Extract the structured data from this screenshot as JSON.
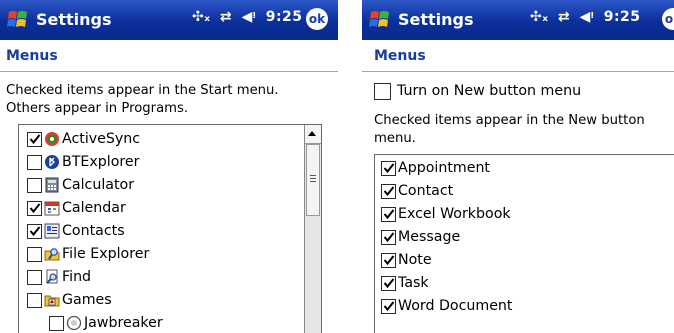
{
  "left": {
    "title": "Settings",
    "time": "9:25",
    "ok_label": "ok",
    "section_header": "Menus",
    "description_lines": [
      "Checked items appear in the Start menu.",
      "Others appear in Programs."
    ],
    "items": [
      {
        "label": "ActiveSync",
        "checked": true,
        "icon": "activesync-icon"
      },
      {
        "label": "BTExplorer",
        "checked": false,
        "icon": "btexplorer-icon"
      },
      {
        "label": "Calculator",
        "checked": false,
        "icon": "calculator-icon"
      },
      {
        "label": "Calendar",
        "checked": true,
        "icon": "calendar-icon"
      },
      {
        "label": "Contacts",
        "checked": true,
        "icon": "contacts-icon"
      },
      {
        "label": "File Explorer",
        "checked": false,
        "icon": "file-explorer-icon"
      },
      {
        "label": "Find",
        "checked": false,
        "icon": "find-icon"
      },
      {
        "label": "Games",
        "checked": false,
        "icon": "games-folder-icon"
      },
      {
        "label": "Jawbreaker",
        "checked": false,
        "icon": "jawbreaker-icon"
      }
    ]
  },
  "right": {
    "title": "Settings",
    "time": "9:25",
    "ok_label": "ok",
    "section_header": "Menus",
    "new_button_option": {
      "label": "Turn on New button menu",
      "checked": false
    },
    "description_lines": [
      "Checked items appear in the New button",
      "menu."
    ],
    "items": [
      {
        "label": "Appointment",
        "checked": true
      },
      {
        "label": "Contact",
        "checked": true
      },
      {
        "label": "Excel Workbook",
        "checked": true
      },
      {
        "label": "Message",
        "checked": true
      },
      {
        "label": "Note",
        "checked": true
      },
      {
        "label": "Task",
        "checked": true
      },
      {
        "label": "Word Document",
        "checked": true
      }
    ]
  },
  "colors": {
    "titlebar": "#0b2f9a",
    "header_text": "#1a3d9c"
  }
}
